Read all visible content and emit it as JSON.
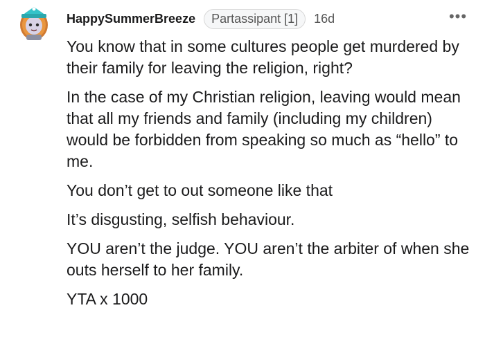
{
  "comment": {
    "username": "HappySummerBreeze",
    "flair": "Partassipant [1]",
    "age": "16d",
    "more_icon": "•••",
    "paragraphs": [
      "You know that in some cultures people get murdered by their family for leaving the religion, right?",
      "In the case of my Christian religion, leaving would mean that all my friends and family (including my children) would be forbidden from speaking so much as “hello” to me.",
      "You don’t get to out someone like that",
      "It’s disgusting, selfish behaviour.",
      "YOU aren’t the judge. YOU aren’t the arbiter of when she outs herself to her family.",
      "YTA x 1000"
    ]
  },
  "colors": {
    "text": "#1a1a1b",
    "muted": "#555555",
    "flair_bg": "#f6f7f8",
    "avatar_teal": "#34c3c9",
    "avatar_orange": "#e48a3c"
  }
}
